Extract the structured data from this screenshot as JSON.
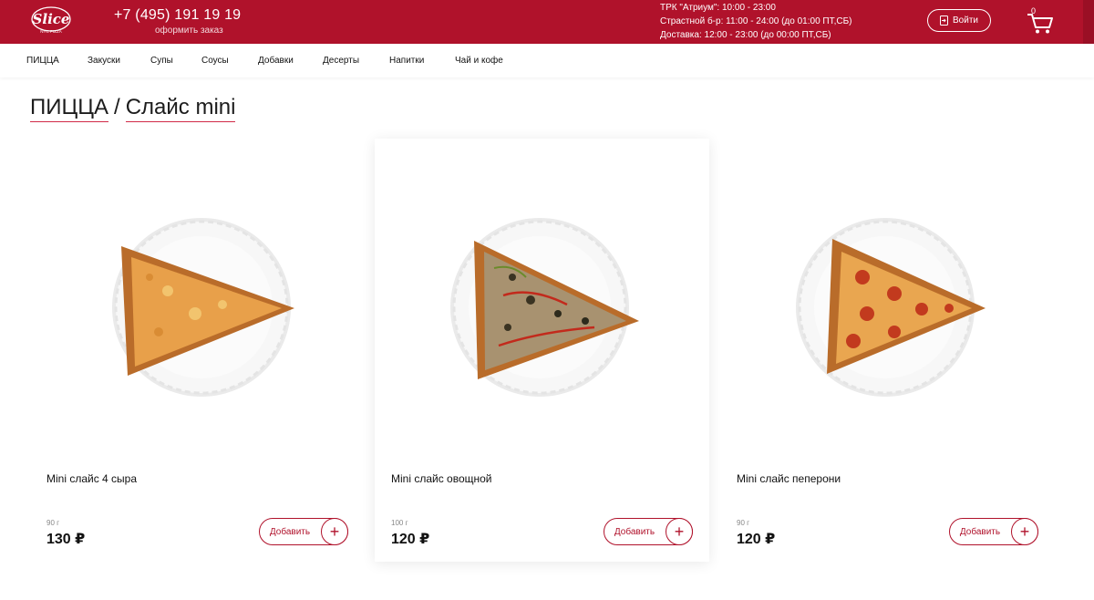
{
  "header": {
    "logo_text": "Slice",
    "logo_sub": "NYC PIZZA",
    "phone": "+7 (495) 191 19 19",
    "order_link": "оформить заказ",
    "hours": [
      "ТРК \"Атриум\": 10:00 - 23:00",
      "Страстной б-р: 11:00 - 24:00 (до 01:00 ПТ,СБ)",
      "Доставка: 12:00 - 23:00 (до 00:00 ПТ,СБ)"
    ],
    "login_label": "Войти",
    "cart_count": "0",
    "brand_color": "#b0122b"
  },
  "nav": {
    "items": [
      "ПИЦЦА",
      "Закуски",
      "Супы",
      "Соусы",
      "Добавки",
      "Десерты",
      "Напитки",
      "Чай и кофе"
    ]
  },
  "breadcrumb": {
    "category": "ПИЦЦА",
    "separator": "/",
    "current": "Слайс mini"
  },
  "products": [
    {
      "name": "Mini слайс 4 сыра",
      "weight": "90 г",
      "price": "130 ₽",
      "add_label": "Добавить",
      "pizza": "cheese"
    },
    {
      "name": "Mini слайс овощной",
      "weight": "100 г",
      "price": "120 ₽",
      "add_label": "Добавить",
      "pizza": "veggie"
    },
    {
      "name": "Mini слайс пеперони",
      "weight": "90 г",
      "price": "120 ₽",
      "add_label": "Добавить",
      "pizza": "pepperoni"
    }
  ]
}
